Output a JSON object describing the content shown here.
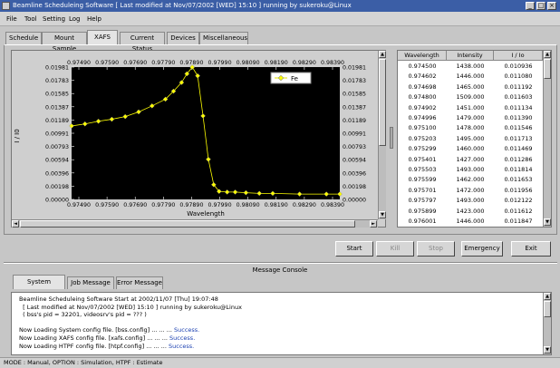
{
  "window": {
    "title": "Beamline Scheduleing Software [ Last modified at Nov/07/2002 [WED] 15:10 ] running by sukeroku@Linux",
    "buttons": [
      "_",
      "□",
      "×"
    ]
  },
  "menu": [
    "File",
    "Tool",
    "Setting",
    "Log",
    "Help"
  ],
  "tabs": [
    "Schedule",
    "Mount Sample",
    "XAFS",
    "Current Status",
    "Devices",
    "Miscellaneous"
  ],
  "active_tab": "XAFS",
  "chart_data": {
    "type": "scatter",
    "legend": "Fe",
    "xlabel": "Wavelength",
    "ylabel": "I / I0",
    "x_ticks": [
      "0.97490",
      "0.97590",
      "0.97690",
      "0.97790",
      "0.97890",
      "0.97990",
      "0.98090",
      "0.98190",
      "0.98290",
      "0.98390"
    ],
    "y_ticks": [
      "0.01981",
      "0.01783",
      "0.01585",
      "0.01387",
      "0.01189",
      "0.00991",
      "0.00793",
      "0.00594",
      "0.00396",
      "0.00198",
      "0.00000"
    ],
    "xlim": [
      0.9745,
      0.9845
    ],
    "ylim": [
      0,
      0.01981
    ],
    "series": [
      {
        "name": "Fe",
        "color": "#ffff00",
        "x": [
          0.9745,
          0.975,
          0.9755,
          0.976,
          0.9765,
          0.977,
          0.9775,
          0.978,
          0.9783,
          0.9786,
          0.9788,
          0.979,
          0.9792,
          0.9794,
          0.9796,
          0.9798,
          0.98,
          0.9803,
          0.9806,
          0.981,
          0.9815,
          0.982,
          0.983,
          0.984,
          0.9845
        ],
        "y": [
          0.011,
          0.0113,
          0.0117,
          0.012,
          0.0124,
          0.0131,
          0.014,
          0.015,
          0.0162,
          0.0175,
          0.0188,
          0.0198,
          0.0185,
          0.0125,
          0.006,
          0.0022,
          0.0012,
          0.0011,
          0.0011,
          0.001,
          0.0009,
          0.0009,
          0.0008,
          0.0008,
          0.0008
        ]
      }
    ]
  },
  "table": {
    "columns": [
      "Wavelength",
      "Intensity",
      "I / Io"
    ],
    "rows": [
      [
        "0.974500",
        "1438.000",
        "0.010936"
      ],
      [
        "0.974602",
        "1446.000",
        "0.011080"
      ],
      [
        "0.974698",
        "1465.000",
        "0.011192"
      ],
      [
        "0.974800",
        "1509.000",
        "0.011603"
      ],
      [
        "0.974902",
        "1451.000",
        "0.011134"
      ],
      [
        "0.974996",
        "1479.000",
        "0.011390"
      ],
      [
        "0.975100",
        "1478.000",
        "0.011546"
      ],
      [
        "0.975203",
        "1495.000",
        "0.011713"
      ],
      [
        "0.975299",
        "1460.000",
        "0.011469"
      ],
      [
        "0.975401",
        "1427.000",
        "0.011286"
      ],
      [
        "0.975503",
        "1493.000",
        "0.011814"
      ],
      [
        "0.975599",
        "1462.000",
        "0.011653"
      ],
      [
        "0.975701",
        "1472.000",
        "0.011956"
      ],
      [
        "0.975797",
        "1493.000",
        "0.012122"
      ],
      [
        "0.975899",
        "1423.000",
        "0.011612"
      ],
      [
        "0.976001",
        "1446.000",
        "0.011847"
      ]
    ]
  },
  "controls": {
    "start": "Start",
    "kill": "Kill",
    "stop": "Stop",
    "emergency": "Emergency",
    "exit": "Exit"
  },
  "console": {
    "title": "Message Console",
    "tabs": [
      "System Message",
      "Job Message",
      "Error Message"
    ],
    "lines": [
      {
        "text": "Beamline Scheduleing Software Start at 2002/11/07 [Thu] 19:07:48",
        "ok": ""
      },
      {
        "text": "  [ Last modified at Nov/07/2002 [WED] 15:10 ] running by sukeroku@Linux",
        "ok": ""
      },
      {
        "text": "  ( bss's pid = 32201, videosrv's pid = ??? )",
        "ok": ""
      },
      {
        "text": "",
        "ok": ""
      },
      {
        "text": "Now Loading System config file. [bss.config] ... ... ... ",
        "ok": "Success."
      },
      {
        "text": "Now Loading XAFS config file. [xafs.config] ... ... ... ",
        "ok": "Success."
      },
      {
        "text": "Now Loading HTPF config file. [htpf.config] ... ... ... ",
        "ok": "Success."
      }
    ]
  },
  "status_bar": "MODE : Manual,   OPTION : Simulation,   HTPF : Estimate"
}
